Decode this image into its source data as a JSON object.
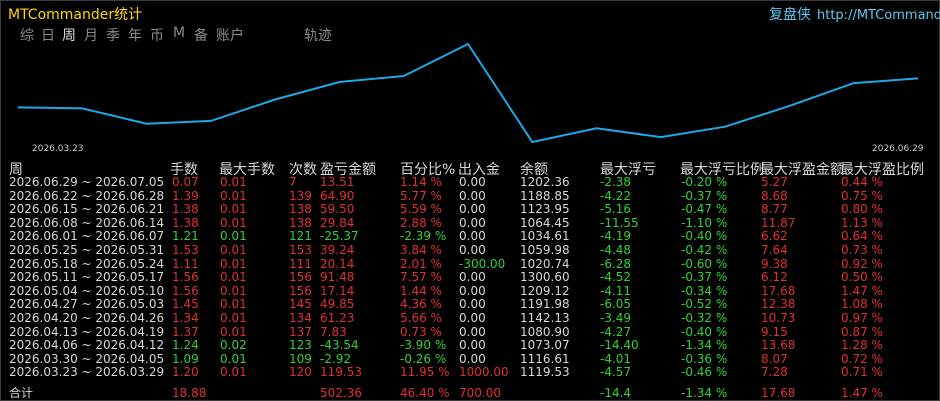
{
  "app": {
    "title": "MTCommander统计",
    "brand_name": "复盘侠",
    "brand_url": "http://MTCommande"
  },
  "tabs": [
    {
      "label": "综",
      "active": false
    },
    {
      "label": "日",
      "active": false
    },
    {
      "label": "周",
      "active": true
    },
    {
      "label": "月",
      "active": false
    },
    {
      "label": "季",
      "active": false
    },
    {
      "label": "年",
      "active": false
    },
    {
      "label": "币",
      "active": false
    },
    {
      "label": "M",
      "active": false
    },
    {
      "label": "备",
      "active": false
    },
    {
      "label": "账户",
      "active": false
    },
    {
      "label": "轨迹",
      "active": false
    }
  ],
  "chart_data": {
    "type": "line",
    "x": [
      "2026.03.23",
      "2026.03.30",
      "2026.04.06",
      "2026.04.13",
      "2026.04.20",
      "2026.04.27",
      "2026.05.04",
      "2026.05.11",
      "2026.05.18",
      "2026.05.25",
      "2026.06.01",
      "2026.06.08",
      "2026.06.15",
      "2026.06.22",
      "2026.06.29"
    ],
    "values": [
      1119.53,
      1116.61,
      1073.07,
      1080.9,
      1142.13,
      1191.98,
      1209.12,
      1300.6,
      1020.74,
      1059.98,
      1034.61,
      1064.45,
      1123.95,
      1188.85,
      1202.36
    ],
    "x_start_label": "2026.03.23",
    "x_end_label": "2026.06.29",
    "line_color": "#1ea8e6",
    "grid": false
  },
  "columns": [
    "周",
    "手数",
    "最大手数",
    "次数",
    "盈亏金额",
    "百分比%",
    "出入金",
    "余额",
    "最大浮亏",
    "最大浮亏比例",
    "最大浮盈金额",
    "最大浮盈比例"
  ],
  "rows": [
    {
      "period": "2026.06.29 ~ 2026.07.05",
      "lots": "0.07",
      "max_lots": "0.01",
      "trades": "7",
      "pnl": "13.51",
      "pct": "1.14 %",
      "flow": "0.00",
      "balance": "1202.36",
      "max_float_loss": "-2.38",
      "max_float_loss_pct": "-0.20 %",
      "max_float_profit": "5.27",
      "max_float_profit_pct": "0.44 %",
      "sign": "pos"
    },
    {
      "period": "2026.06.22 ~ 2026.06.28",
      "lots": "1.39",
      "max_lots": "0.01",
      "trades": "139",
      "pnl": "64.90",
      "pct": "5.77 %",
      "flow": "0.00",
      "balance": "1188.85",
      "max_float_loss": "-4.22",
      "max_float_loss_pct": "-0.37 %",
      "max_float_profit": "8.68",
      "max_float_profit_pct": "0.75 %",
      "sign": "pos"
    },
    {
      "period": "2026.06.15 ~ 2026.06.21",
      "lots": "1.38",
      "max_lots": "0.01",
      "trades": "138",
      "pnl": "59.50",
      "pct": "5.59 %",
      "flow": "0.00",
      "balance": "1123.95",
      "max_float_loss": "-5.16",
      "max_float_loss_pct": "-0.47 %",
      "max_float_profit": "8.77",
      "max_float_profit_pct": "0.80 %",
      "sign": "pos"
    },
    {
      "period": "2026.06.08 ~ 2026.06.14",
      "lots": "1.38",
      "max_lots": "0.01",
      "trades": "138",
      "pnl": "29.84",
      "pct": "2.88 %",
      "flow": "0.00",
      "balance": "1064.45",
      "max_float_loss": "-11.55",
      "max_float_loss_pct": "-1.10 %",
      "max_float_profit": "11.87",
      "max_float_profit_pct": "1.13 %",
      "sign": "pos"
    },
    {
      "period": "2026.06.01 ~ 2026.06.07",
      "lots": "1.21",
      "max_lots": "0.01",
      "trades": "121",
      "pnl": "-25.37",
      "pct": "-2.39 %",
      "flow": "0.00",
      "balance": "1034.61",
      "max_float_loss": "-4.19",
      "max_float_loss_pct": "-0.40 %",
      "max_float_profit": "6.62",
      "max_float_profit_pct": "0.64 %",
      "sign": "neg"
    },
    {
      "period": "2026.05.25 ~ 2026.05.31",
      "lots": "1.53",
      "max_lots": "0.01",
      "trades": "153",
      "pnl": "39.24",
      "pct": "3.84 %",
      "flow": "0.00",
      "balance": "1059.98",
      "max_float_loss": "-4.48",
      "max_float_loss_pct": "-0.42 %",
      "max_float_profit": "7.64",
      "max_float_profit_pct": "0.73 %",
      "sign": "pos"
    },
    {
      "period": "2026.05.18 ~ 2026.05.24",
      "lots": "1.11",
      "max_lots": "0.01",
      "trades": "111",
      "pnl": "20.14",
      "pct": "2.01 %",
      "flow": "-300.00",
      "balance": "1020.74",
      "max_float_loss": "-6.28",
      "max_float_loss_pct": "-0.60 %",
      "max_float_profit": "9.38",
      "max_float_profit_pct": "0.92 %",
      "sign": "pos"
    },
    {
      "period": "2026.05.11 ~ 2026.05.17",
      "lots": "1.56",
      "max_lots": "0.01",
      "trades": "156",
      "pnl": "91.48",
      "pct": "7.57 %",
      "flow": "0.00",
      "balance": "1300.60",
      "max_float_loss": "-4.52",
      "max_float_loss_pct": "-0.37 %",
      "max_float_profit": "6.12",
      "max_float_profit_pct": "0.50 %",
      "sign": "pos"
    },
    {
      "period": "2026.05.04 ~ 2026.05.10",
      "lots": "1.56",
      "max_lots": "0.01",
      "trades": "156",
      "pnl": "17.14",
      "pct": "1.44 %",
      "flow": "0.00",
      "balance": "1209.12",
      "max_float_loss": "-4.11",
      "max_float_loss_pct": "-0.34 %",
      "max_float_profit": "17.68",
      "max_float_profit_pct": "1.47 %",
      "sign": "pos"
    },
    {
      "period": "2026.04.27 ~ 2026.05.03",
      "lots": "1.45",
      "max_lots": "0.01",
      "trades": "145",
      "pnl": "49.85",
      "pct": "4.36 %",
      "flow": "0.00",
      "balance": "1191.98",
      "max_float_loss": "-6.05",
      "max_float_loss_pct": "-0.52 %",
      "max_float_profit": "12.38",
      "max_float_profit_pct": "1.08 %",
      "sign": "pos"
    },
    {
      "period": "2026.04.20 ~ 2026.04.26",
      "lots": "1.34",
      "max_lots": "0.01",
      "trades": "134",
      "pnl": "61.23",
      "pct": "5.66 %",
      "flow": "0.00",
      "balance": "1142.13",
      "max_float_loss": "-3.49",
      "max_float_loss_pct": "-0.32 %",
      "max_float_profit": "10.73",
      "max_float_profit_pct": "0.97 %",
      "sign": "pos"
    },
    {
      "period": "2026.04.13 ~ 2026.04.19",
      "lots": "1.37",
      "max_lots": "0.01",
      "trades": "137",
      "pnl": "7.83",
      "pct": "0.73 %",
      "flow": "0.00",
      "balance": "1080.90",
      "max_float_loss": "-4.27",
      "max_float_loss_pct": "-0.40 %",
      "max_float_profit": "9.15",
      "max_float_profit_pct": "0.87 %",
      "sign": "pos"
    },
    {
      "period": "2026.04.06 ~ 2026.04.12",
      "lots": "1.24",
      "max_lots": "0.02",
      "trades": "123",
      "pnl": "-43.54",
      "pct": "-3.90 %",
      "flow": "0.00",
      "balance": "1073.07",
      "max_float_loss": "-14.40",
      "max_float_loss_pct": "-1.34 %",
      "max_float_profit": "13.68",
      "max_float_profit_pct": "1.28 %",
      "sign": "neg"
    },
    {
      "period": "2026.03.30 ~ 2026.04.05",
      "lots": "1.09",
      "max_lots": "0.01",
      "trades": "109",
      "pnl": "-2.92",
      "pct": "-0.26 %",
      "flow": "0.00",
      "balance": "1116.61",
      "max_float_loss": "-4.01",
      "max_float_loss_pct": "-0.36 %",
      "max_float_profit": "8.07",
      "max_float_profit_pct": "0.72 %",
      "sign": "neg"
    },
    {
      "period": "2026.03.23 ~ 2026.03.29",
      "lots": "1.20",
      "max_lots": "0.01",
      "trades": "120",
      "pnl": "119.53",
      "pct": "11.95 %",
      "flow": "1000.00",
      "balance": "1119.53",
      "max_float_loss": "-4.57",
      "max_float_loss_pct": "-0.46 %",
      "max_float_profit": "7.28",
      "max_float_profit_pct": "0.71 %",
      "sign": "pos"
    }
  ],
  "total": {
    "label": "合计",
    "lots": "18.88",
    "pnl": "502.36",
    "pct": "46.40 %",
    "flow": "700.00",
    "max_float_loss": "-14.4",
    "max_float_loss_pct": "-1.34 %",
    "max_float_profit": "17.68",
    "max_float_profit_pct": "1.47 %"
  },
  "colors": {
    "positive": "#e03030",
    "negative": "#32d232",
    "title": "#ffd800",
    "brand": "#5fc8f0",
    "line": "#1ea8e6"
  }
}
